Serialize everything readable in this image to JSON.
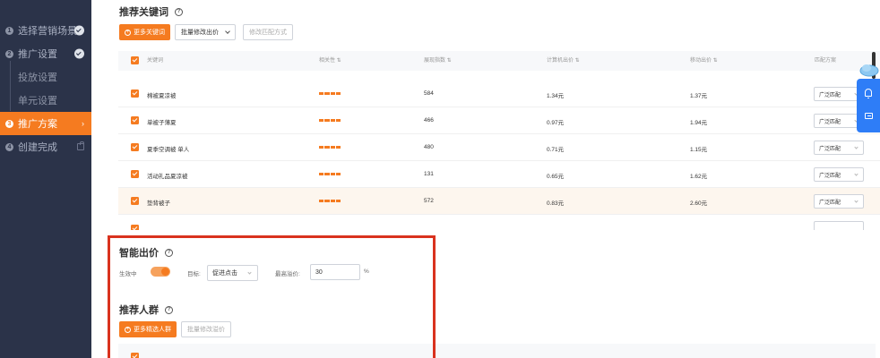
{
  "sidebar": {
    "steps": [
      {
        "num": "1",
        "label": "选择营销场景",
        "status": "done"
      },
      {
        "num": "2",
        "label": "推广设置",
        "status": "done"
      },
      {
        "num": "",
        "label": "投放设置",
        "status": "sub"
      },
      {
        "num": "",
        "label": "单元设置",
        "status": "sub"
      },
      {
        "num": "3",
        "label": "推广方案",
        "status": "active"
      },
      {
        "num": "4",
        "label": "创建完成",
        "status": "locked"
      }
    ]
  },
  "keywords_section": {
    "title": "推荐关键词",
    "help": "?",
    "more_keywords_button": "更多关键词",
    "batch_bid_button": "批量修改出价",
    "match_mode_button": "修改匹配方式",
    "columns": {
      "keyword": "关键词",
      "relevance": "相关性 ⇅",
      "impressions": "展现指数 ⇅",
      "computed_bid": "计算机出价 ⇅",
      "mobile_bid": "移动出价 ⇅",
      "match": "匹配方案"
    },
    "rows": [
      {
        "keyword": "棉被夏凉被",
        "relevance": 4,
        "impressions": "584",
        "computed_bid": "1.34元",
        "mobile_bid": "1.37元",
        "match": "广泛匹配"
      },
      {
        "keyword": "单被子薄夏",
        "relevance": 4,
        "impressions": "466",
        "computed_bid": "0.97元",
        "mobile_bid": "1.94元",
        "match": "广泛匹配"
      },
      {
        "keyword": "夏季空调被 单人",
        "relevance": 4,
        "impressions": "480",
        "computed_bid": "0.71元",
        "mobile_bid": "1.15元",
        "match": "广泛匹配"
      },
      {
        "keyword": "活动礼品夏凉被",
        "relevance": 4,
        "impressions": "131",
        "computed_bid": "0.65元",
        "mobile_bid": "1.62元",
        "match": "广泛匹配"
      },
      {
        "keyword": "垫背被子",
        "relevance": 4,
        "impressions": "572",
        "computed_bid": "0.83元",
        "mobile_bid": "2.60元",
        "match": "广泛匹配"
      }
    ]
  },
  "smart_bid": {
    "title": "智能出价",
    "help": "?",
    "status_label": "生效中",
    "enabled": true,
    "goal_label": "目标:",
    "goal_value": "促进点击",
    "max_premium_label": "最高溢价:",
    "max_premium_value": "30",
    "percent_sign": "%"
  },
  "audience_section": {
    "title": "推荐人群",
    "help": "?",
    "more_audience_button": "更多精选人群",
    "batch_premium_button": "批量修改溢价"
  },
  "colors": {
    "accent": "#f57b20",
    "sidebar_bg": "#2b3349",
    "highlight": "#d9321e",
    "float_panel": "#2e7df7"
  }
}
